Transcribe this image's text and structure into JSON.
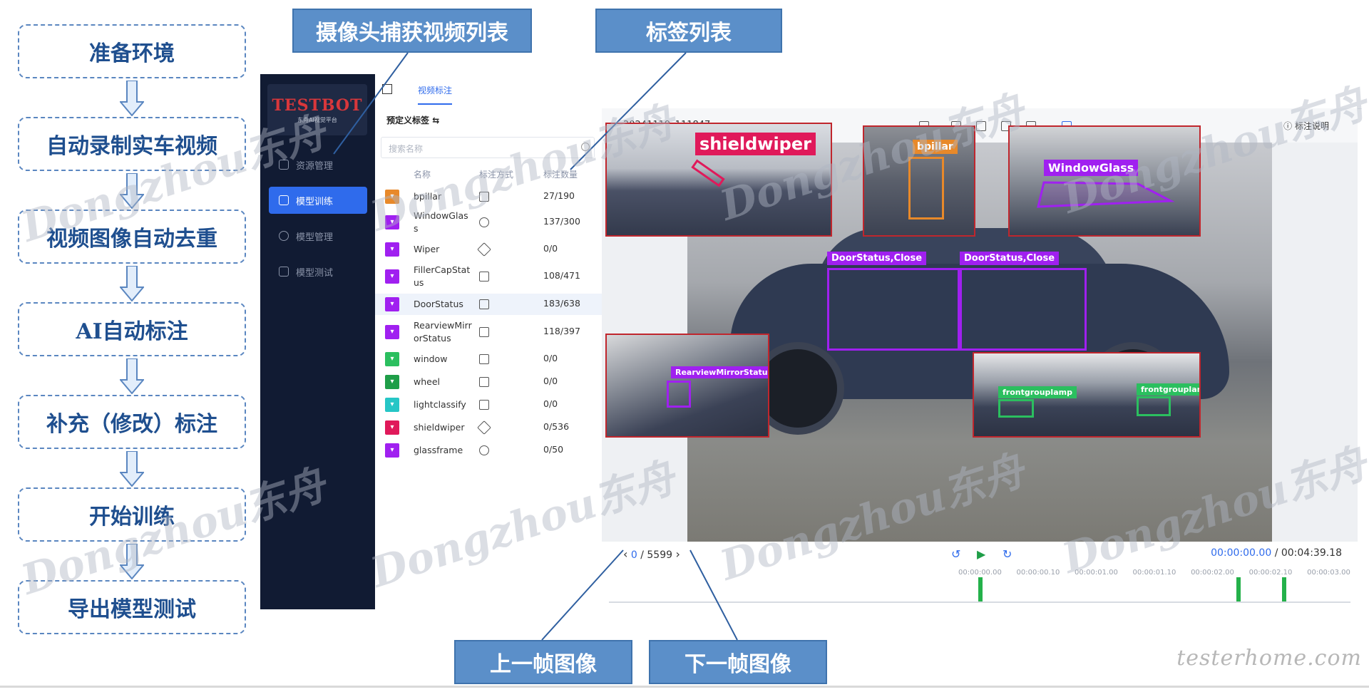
{
  "flow": {
    "steps": [
      "准备环境",
      "自动录制实车视频",
      "视频图像自动去重",
      "AI自动标注",
      "补充（修改）标注",
      "开始训练",
      "导出模型测试"
    ],
    "border_color": "#5a86c0",
    "text_color": "#1f4f8f"
  },
  "callouts": {
    "video_list": "摄像头捕获视频列表",
    "label_list": "标签列表",
    "prev_frame": "上一帧图像",
    "next_frame": "下一帧图像",
    "color": "#5b8fc9"
  },
  "app": {
    "logo": "TESTBOT",
    "logo_sub": "东舟AI视觉平台",
    "sidebar": [
      {
        "label": "资源管理",
        "active": false
      },
      {
        "label": "模型训练",
        "active": true
      },
      {
        "label": "模型管理",
        "active": false
      },
      {
        "label": "模型测试",
        "active": false
      }
    ],
    "tab": "视频标注",
    "panel_title": "预定义标签",
    "search_placeholder": "搜索名称",
    "columns": {
      "name": "名称",
      "mode": "标注方式",
      "count": "标注数量"
    },
    "labels": [
      {
        "name": "bpillar",
        "count": "27/190",
        "color": "#e8892a"
      },
      {
        "name": "WindowGlass",
        "count": "137/300",
        "color": "#a020f0"
      },
      {
        "name": "Wiper",
        "count": "0/0",
        "color": "#a020f0"
      },
      {
        "name": "FillerCapStatus",
        "count": "108/471",
        "color": "#a020f0"
      },
      {
        "name": "DoorStatus",
        "count": "183/638",
        "color": "#a020f0"
      },
      {
        "name": "RearviewMirrorStatus",
        "count": "118/397",
        "color": "#a020f0"
      },
      {
        "name": "window",
        "count": "0/0",
        "color": "#2bbf5f"
      },
      {
        "name": "wheel",
        "count": "0/0",
        "color": "#1f9e48"
      },
      {
        "name": "lightclassify",
        "count": "0/0",
        "color": "#26c6c6"
      },
      {
        "name": "shieldwiper",
        "count": "0/536",
        "color": "#e0195a"
      },
      {
        "name": "glassframe",
        "count": "0/50",
        "color": "#a020f0"
      }
    ],
    "viewer": {
      "video_name": "20241119_111847",
      "help": "标注说明",
      "annotations": {
        "shieldwiper": "shieldwiper",
        "bpillar": "bpillar",
        "windowglass": "WindowGlass",
        "door1": "DoorStatus,Close",
        "door2": "DoorStatus,Close",
        "mirror": "RearviewMirrorStatus,Open",
        "lamp1": "frontgrouplamp",
        "lamp2": "frontgrouplamp"
      },
      "frame_current": "0",
      "frame_total": "/ 5599",
      "time_current": "00:00:00.00",
      "time_total": "/ 00:04:39.18",
      "ticks": [
        "00:00:00.00",
        "00:00:00.10",
        "00:00:01.00",
        "00:00:01.10",
        "00:00:02.00",
        "00:00:02.10",
        "00:00:03.00"
      ]
    }
  },
  "watermark": "Dongzhou东舟",
  "site": "testerhome.com"
}
